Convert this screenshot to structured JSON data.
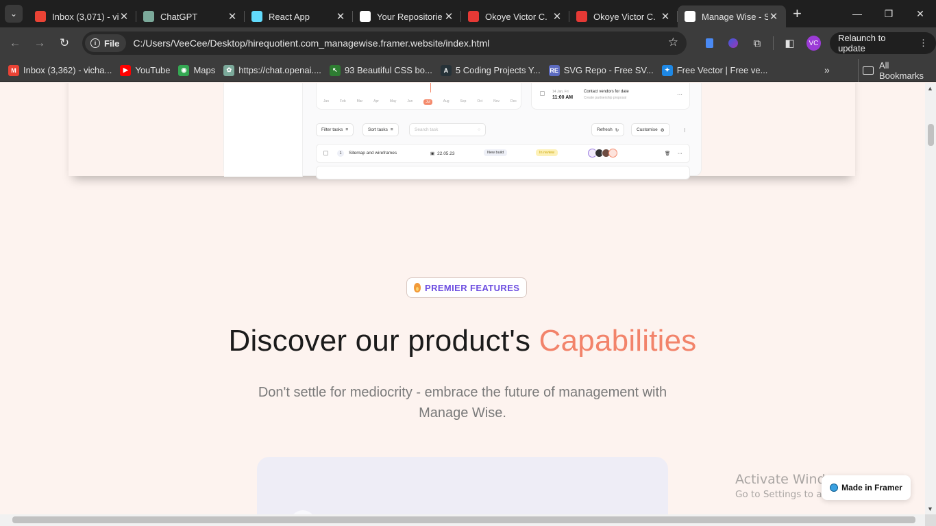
{
  "browser": {
    "tabs": [
      {
        "label": "Inbox (3,071) - vi",
        "icon": "gmail-icon",
        "color": "#ea4335"
      },
      {
        "label": "ChatGPT",
        "icon": "chatgpt-icon",
        "color": "#7ba99a"
      },
      {
        "label": "React App",
        "icon": "react-icon",
        "color": "#61dafb"
      },
      {
        "label": "Your Repositorie",
        "icon": "github-icon",
        "color": "#ffffff"
      },
      {
        "label": "Okoye Victor C.",
        "icon": "doc-icon",
        "color": "#e53935"
      },
      {
        "label": "Okoye Victor C.",
        "icon": "doc-icon",
        "color": "#e53935"
      },
      {
        "label": "Manage Wise - S",
        "icon": "managewise-icon",
        "color": "#ffffff",
        "active": true
      }
    ],
    "url_scheme_label": "File",
    "url": "C:/Users/VeeCee/Desktop/hirequotient.com_managewise.framer.website/index.html",
    "relaunch_label": "Relaunch to update",
    "avatar_initials": "VC",
    "bookmarks": [
      {
        "label": "Inbox (3,362) - vicha...",
        "color": "#ea4335",
        "glyph": "M"
      },
      {
        "label": "YouTube",
        "color": "#ff0000",
        "glyph": "▶"
      },
      {
        "label": "Maps",
        "color": "#34a853",
        "glyph": "◉"
      },
      {
        "label": "https://chat.openai....",
        "color": "#7ba99a",
        "glyph": "✿"
      },
      {
        "label": "93 Beautiful CSS bo...",
        "color": "#2e7d32",
        "glyph": "↖"
      },
      {
        "label": "5 Coding Projects Y...",
        "color": "#263238",
        "glyph": "A"
      },
      {
        "label": "SVG Repo - Free SV...",
        "color": "#5c6bc0",
        "glyph": "RE"
      },
      {
        "label": "Free Vector | Free ve...",
        "color": "#1e88e5",
        "glyph": "✦"
      }
    ],
    "all_bookmarks_label": "All Bookmarks"
  },
  "dashboard_preview": {
    "months": [
      "Jan",
      "Feb",
      "Mar",
      "Apr",
      "May",
      "Jun",
      "Jul",
      "Aug",
      "Sep",
      "Oct",
      "Nov",
      "Dec"
    ],
    "event": {
      "date": "14 Jan, Fri",
      "time": "11:00 AM",
      "title": "Contact vendors for date",
      "subtitle": "Create partnership proposal"
    },
    "filter_label": "Filter tasks",
    "sort_label": "Sort tasks",
    "search_placeholder": "Search task",
    "refresh_label": "Refresh",
    "customise_label": "Customise",
    "task": {
      "index": "1",
      "name": "Sitemap and wireframes",
      "date": "22.05.23",
      "tag": "New build",
      "status": "In review"
    }
  },
  "section": {
    "badge": "PREMIER FEATURES",
    "heading_main": "Discover our product's",
    "heading_accent": "Capabilities",
    "subtext": "Don't settle for mediocrity - embrace the future of management with Manage Wise."
  },
  "framer_badge": "Made in Framer",
  "windows_watermark": {
    "title": "Activate Windows",
    "subtitle": "Go to Settings to activate Windows."
  },
  "colors": {
    "accent": "#f2836a",
    "badge_text": "#6c4de0",
    "page_bg": "#fdf3ef"
  }
}
